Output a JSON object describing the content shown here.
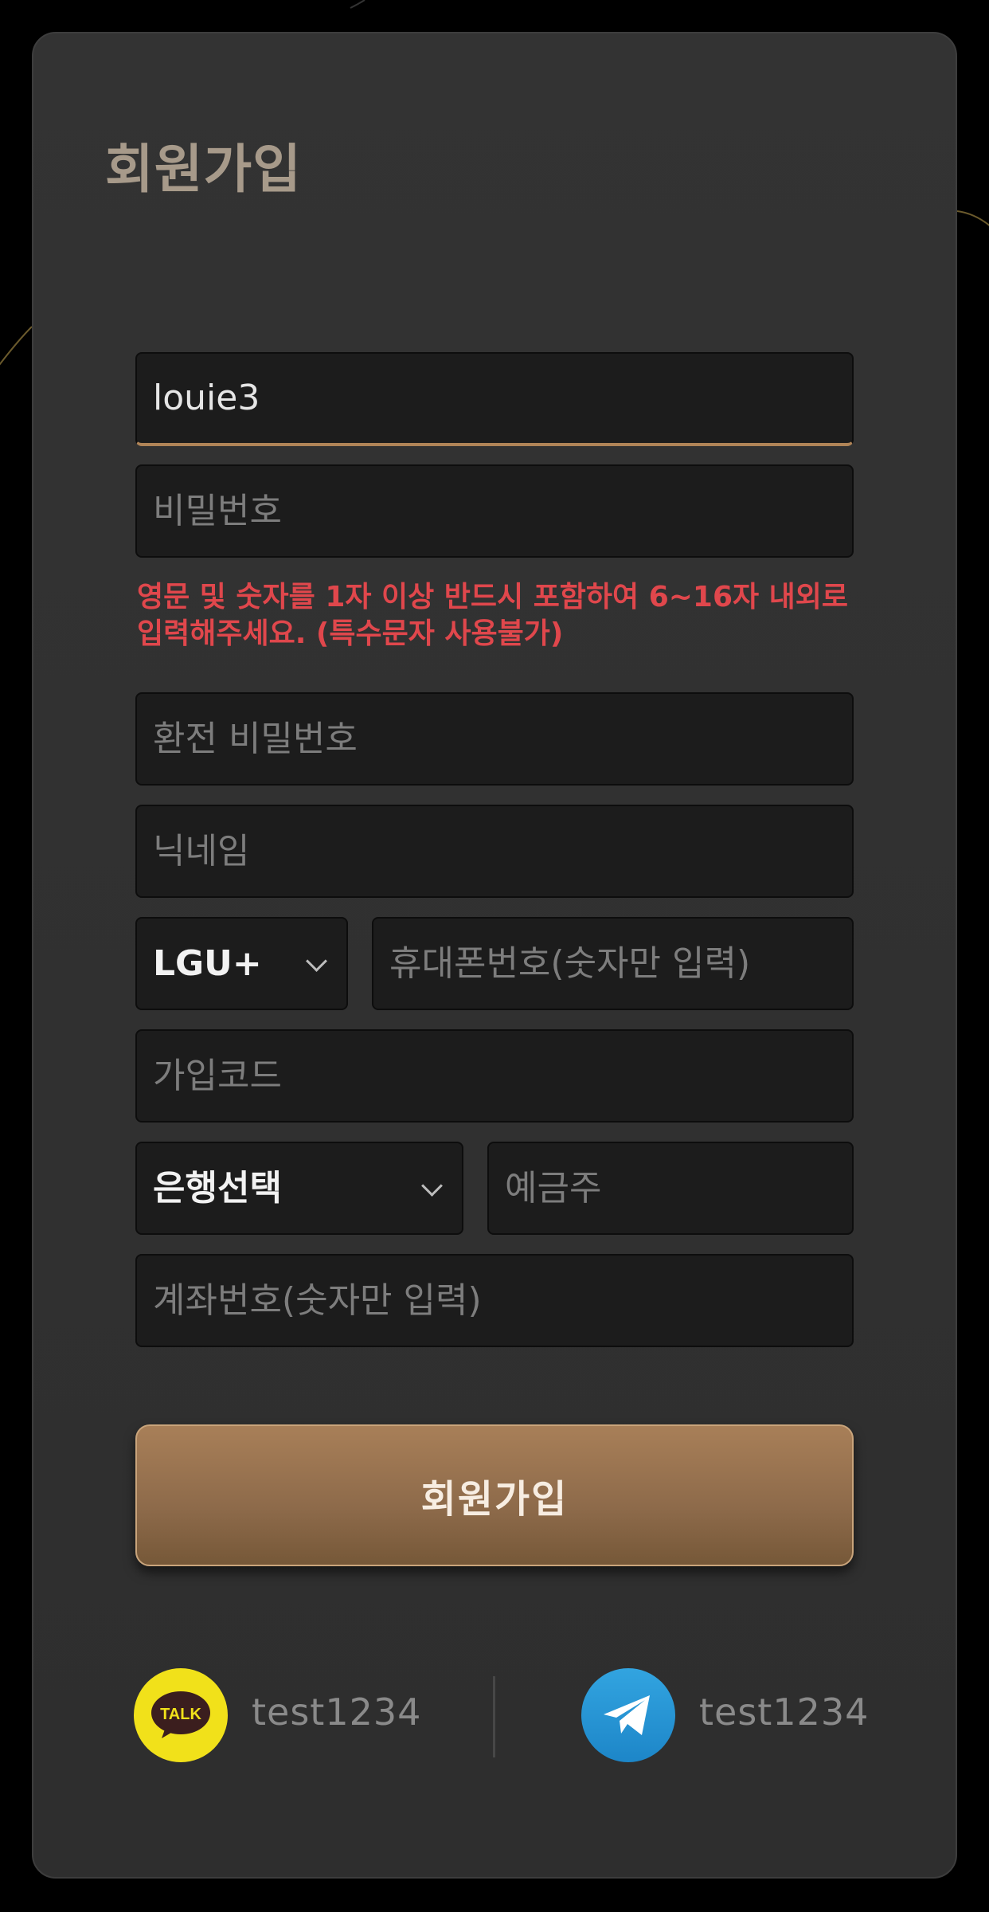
{
  "page": {
    "title": "회원가입"
  },
  "form": {
    "username_value": "louie3",
    "password_placeholder": "비밀번호",
    "password_hint": "영문 및 숫자를 1자 이상 반드시 포함하여 6~16자 내외로 입력해주세요. (특수문자 사용불가)",
    "exchange_password_placeholder": "환전 비밀번호",
    "nickname_placeholder": "닉네임",
    "carrier_selected": "LGU+",
    "phone_placeholder": "휴대폰번호(숫자만 입력)",
    "signup_code_placeholder": "가입코드",
    "bank_selected": "은행선택",
    "account_holder_placeholder": "예금주",
    "account_number_placeholder": "계좌번호(숫자만 입력)",
    "submit_label": "회원가입"
  },
  "contacts": {
    "kakao": {
      "icon": "kakao-talk-icon",
      "icon_text": "TALK",
      "id": "test1234",
      "color": "#f1e11a"
    },
    "telegram": {
      "icon": "telegram-icon",
      "id": "test1234",
      "color": "#2a9ad8"
    }
  },
  "colors": {
    "accent": "#b08457",
    "error": "#e0474c",
    "title": "#a79a8a"
  }
}
